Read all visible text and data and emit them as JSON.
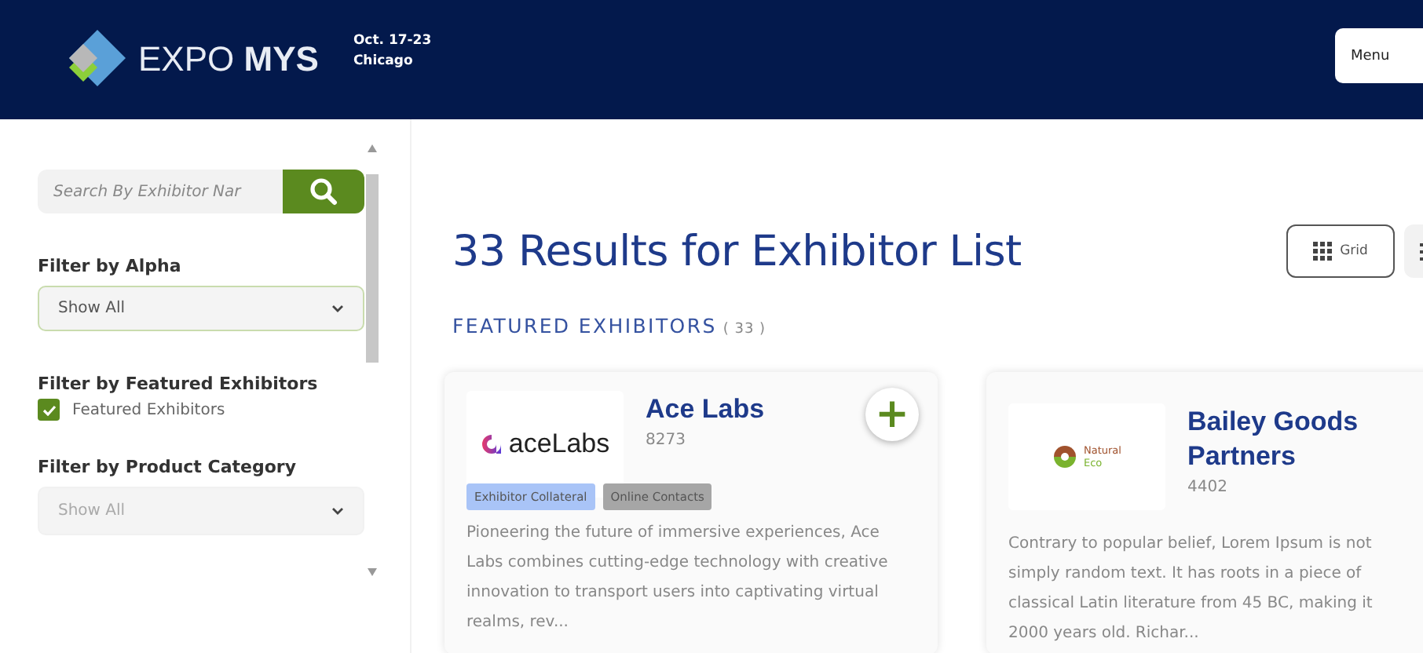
{
  "header": {
    "brand_light": "EXPO",
    "brand_bold": "MYS",
    "dates": "Oct. 17-23",
    "city": "Chicago",
    "menu_button": "Menu"
  },
  "sidebar": {
    "search": {
      "placeholder": "Search By Exhibitor Nar"
    },
    "filters": [
      {
        "kind": "select",
        "label": "Filter by Alpha",
        "value": "Show All",
        "disabled": false
      },
      {
        "kind": "checkbox",
        "label": "Filter by Featured Exhibitors",
        "option": "Featured Exhibitors",
        "checked": true
      },
      {
        "kind": "select",
        "label": "Filter by Product Category",
        "value": "Show All",
        "disabled": true
      }
    ]
  },
  "main": {
    "title": "33 Results for Exhibitor List",
    "views": [
      {
        "label": "Grid",
        "kind": "grid",
        "selected": true
      },
      {
        "kind": "list",
        "selected": false
      }
    ],
    "section": {
      "title": "FEATURED EXHIBITORS",
      "count": "( 33 )"
    },
    "cards": [
      {
        "logo": {
          "kind": "ace",
          "text": "aceLabs"
        },
        "name": "Ace Labs",
        "booth": "8273",
        "action": "+",
        "tags": [
          {
            "label": "Exhibitor Collateral",
            "color": "#a9c4f7"
          },
          {
            "label": "Online Contacts",
            "color": "#a6a6a6"
          }
        ],
        "description": "Pioneering the future of immersive experiences, Ace Labs combines cutting-edge technology with creative innovation to transport users into captivating virtual realms, rev..."
      },
      {
        "logo": {
          "kind": "natural",
          "text": "Natural",
          "subtext": "Eco"
        },
        "name": "Bailey Goods Partners",
        "booth": "4402",
        "description": "Contrary to popular belief, Lorem Ipsum is not simply random text. It has roots in a piece of classical Latin literature from 45 BC, making it 2000 years old. Richar..."
      }
    ]
  }
}
